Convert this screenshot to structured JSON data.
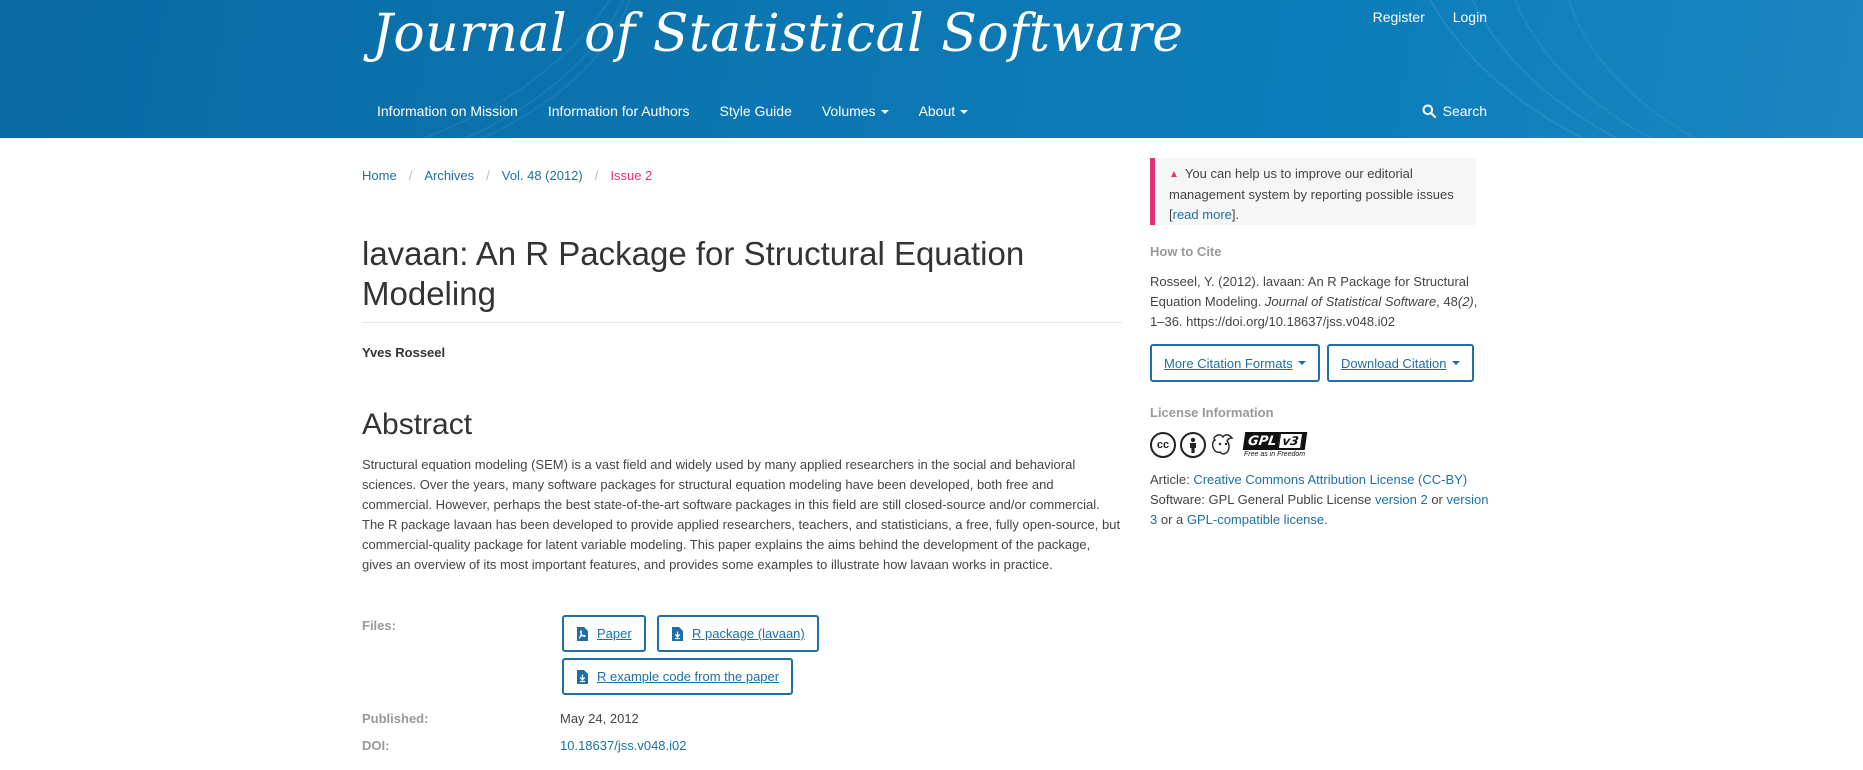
{
  "header": {
    "journal_title": "Journal of Statistical Software",
    "user_nav": {
      "register": "Register",
      "login": "Login"
    },
    "main_nav": {
      "mission": "Information on Mission",
      "authors": "Information for Authors",
      "style_guide": "Style Guide",
      "volumes": "Volumes",
      "about": "About"
    },
    "search_label": "Search"
  },
  "breadcrumb": {
    "home": "Home",
    "archives": "Archives",
    "volume": "Vol. 48 (2012)",
    "current": "Issue 2",
    "separator": "/"
  },
  "article": {
    "title": "lavaan: An R Package for Structural Equation Modeling",
    "author": "Yves Rosseel",
    "abstract_heading": "Abstract",
    "abstract": "Structural equation modeling (SEM) is a vast field and widely used by many applied researchers in the social and behavioral sciences. Over the years, many software packages for structural equation modeling have been developed, both free and commercial. However, perhaps the best state-of-the-art software packages in this field are still closed-source and/or commercial. The R package lavaan has been developed to provide applied researchers, teachers, and statisticians, a free, fully open-source, but commercial-quality package for latent variable modeling. This paper explains the aims behind the development of the package, gives an overview of its most important features, and provides some examples to illustrate how lavaan works in practice.",
    "files_label": "Files:",
    "files": {
      "paper": "Paper",
      "r_package": "R package (lavaan)",
      "example_code": "R example code from the paper"
    },
    "published_label": "Published:",
    "published_date": "May 24, 2012",
    "doi_label": "DOI:",
    "doi": "10.18637/jss.v048.i02"
  },
  "sidebar": {
    "notice": {
      "text_before": "You can help us to improve our editorial management system by reporting possible issues [",
      "link": "read more",
      "text_after": "]."
    },
    "how_to_cite": {
      "heading": "How to Cite",
      "text_before": "Rosseel, Y. (2012). lavaan: An R Package for Structural Equation Modeling. ",
      "journal": "Journal of Statistical Software",
      "text_mid": ", 48",
      "issue": "(2)",
      "text_after": ", 1–36. https://doi.org/10.18637/jss.v048.i02",
      "more_formats": "More Citation Formats",
      "download": "Download Citation"
    },
    "license": {
      "heading": "License Information",
      "gpl_logo_text": "GPL",
      "gpl_version": "v3",
      "gpl_tagline": "Free as in Freedom",
      "article_prefix": "Article: ",
      "article_link": "Creative Commons Attribution License (CC-BY)",
      "software_prefix": "Software: GPL General Public License ",
      "version2": "version 2",
      "or1": " or ",
      "version3": "version 3",
      "or2": " or a ",
      "gpl_compatible": "GPL-compatible license",
      "period": "."
    }
  },
  "colors": {
    "header_blue": "#0b77b2",
    "link_blue": "#1e6fa5",
    "accent_pink": "#e52f76",
    "muted_gray": "#999999"
  },
  "icons": {
    "search": "search-icon",
    "warning": "warning-triangle-icon",
    "pdf": "pdf-file-icon",
    "download": "download-file-icon",
    "cc": "creative-commons-icon",
    "by": "attribution-icon",
    "gnu": "gnu-icon",
    "gpl": "gplv3-logo"
  }
}
